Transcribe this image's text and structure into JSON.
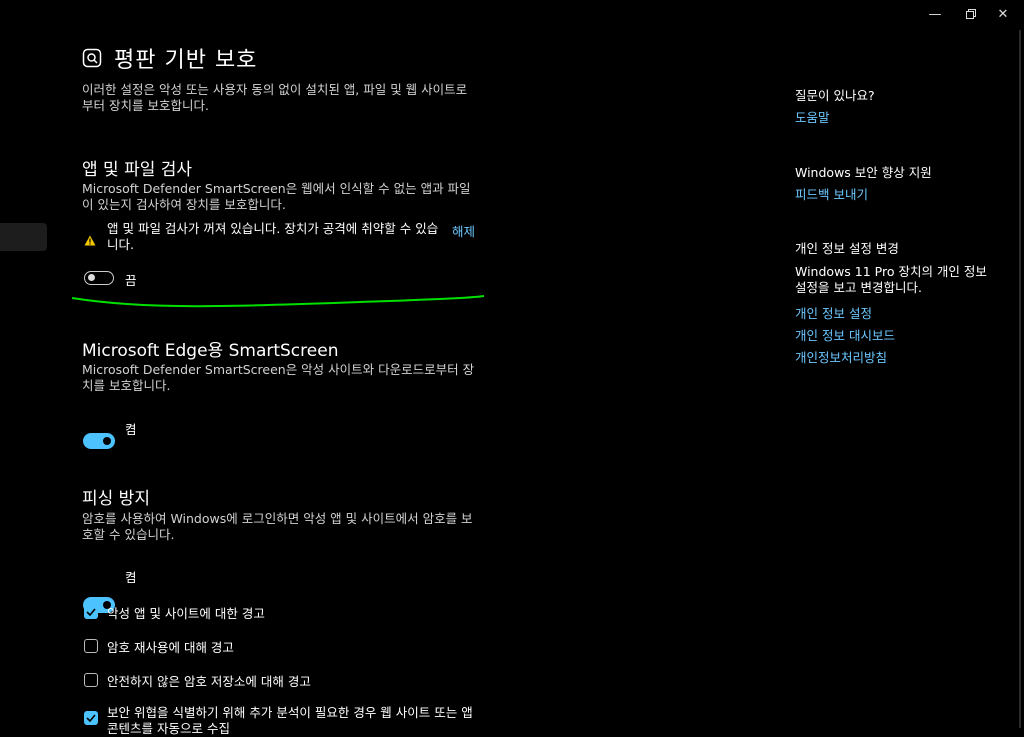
{
  "window": {
    "minimize_icon": "minimize-icon",
    "restore_icon": "restore-icon",
    "close_icon": "close-icon"
  },
  "page": {
    "title": "평판 기반 보호",
    "icon": "reputation-shield-icon",
    "description": "이러한 설정은 악성 또는 사용자 동의 없이 설치된 앱, 파일 및 웹 사이트로부터 장치를 보호합니다."
  },
  "app_file_check": {
    "heading": "앱 및 파일 검사",
    "description": "Microsoft Defender SmartScreen은 웹에서 인식할 수 없는 앱과 파일이 있는지 검사하여 장치를 보호합니다.",
    "warning": "앱 및 파일 검사가 꺼져 있습니다. 장치가 공격에 취약할 수 있습니다.",
    "dismiss_label": "해제",
    "toggle_state": "off",
    "toggle_label": "끔"
  },
  "edge_smartscreen": {
    "heading": "Microsoft Edge용 SmartScreen",
    "description": "Microsoft Defender SmartScreen은 악성 사이트와 다운로드로부터 장치를 보호합니다.",
    "toggle_state": "on",
    "toggle_label": "켬"
  },
  "phishing": {
    "heading": "피싱 방지",
    "description": "암호를 사용하여 Windows에 로그인하면 악성 앱 및 사이트에서 암호를 보호할 수 있습니다.",
    "toggle_state": "on",
    "toggle_label": "켬",
    "options": [
      {
        "label": "악성 앱 및 사이트에 대한 경고",
        "checked": true
      },
      {
        "label": "암호 재사용에 대해 경고",
        "checked": false
      },
      {
        "label": "안전하지 않은 암호 저장소에 대해 경고",
        "checked": false
      },
      {
        "label": "보안 위협을 식별하기 위해 추가 분석이 필요한 경우 웹 사이트 또는 앱 콘텐츠를 자동으로 수집",
        "checked": true
      }
    ]
  },
  "sidebar": {
    "question": {
      "heading": "질문이 있나요?",
      "link": "도움말"
    },
    "improve": {
      "heading": "Windows 보안 향상 지원",
      "link": "피드백 보내기"
    },
    "privacy": {
      "heading": "개인 정보 설정 변경",
      "text": "Windows 11 Pro 장치의 개인 정보 설정을 보고 변경합니다.",
      "links": [
        "개인 정보 설정",
        "개인 정보 대시보드",
        "개인정보처리방침"
      ]
    }
  },
  "colors": {
    "accent": "#4cc2ff",
    "background": "#000000",
    "annotation": "#00e000",
    "warning": "#f3c800"
  }
}
